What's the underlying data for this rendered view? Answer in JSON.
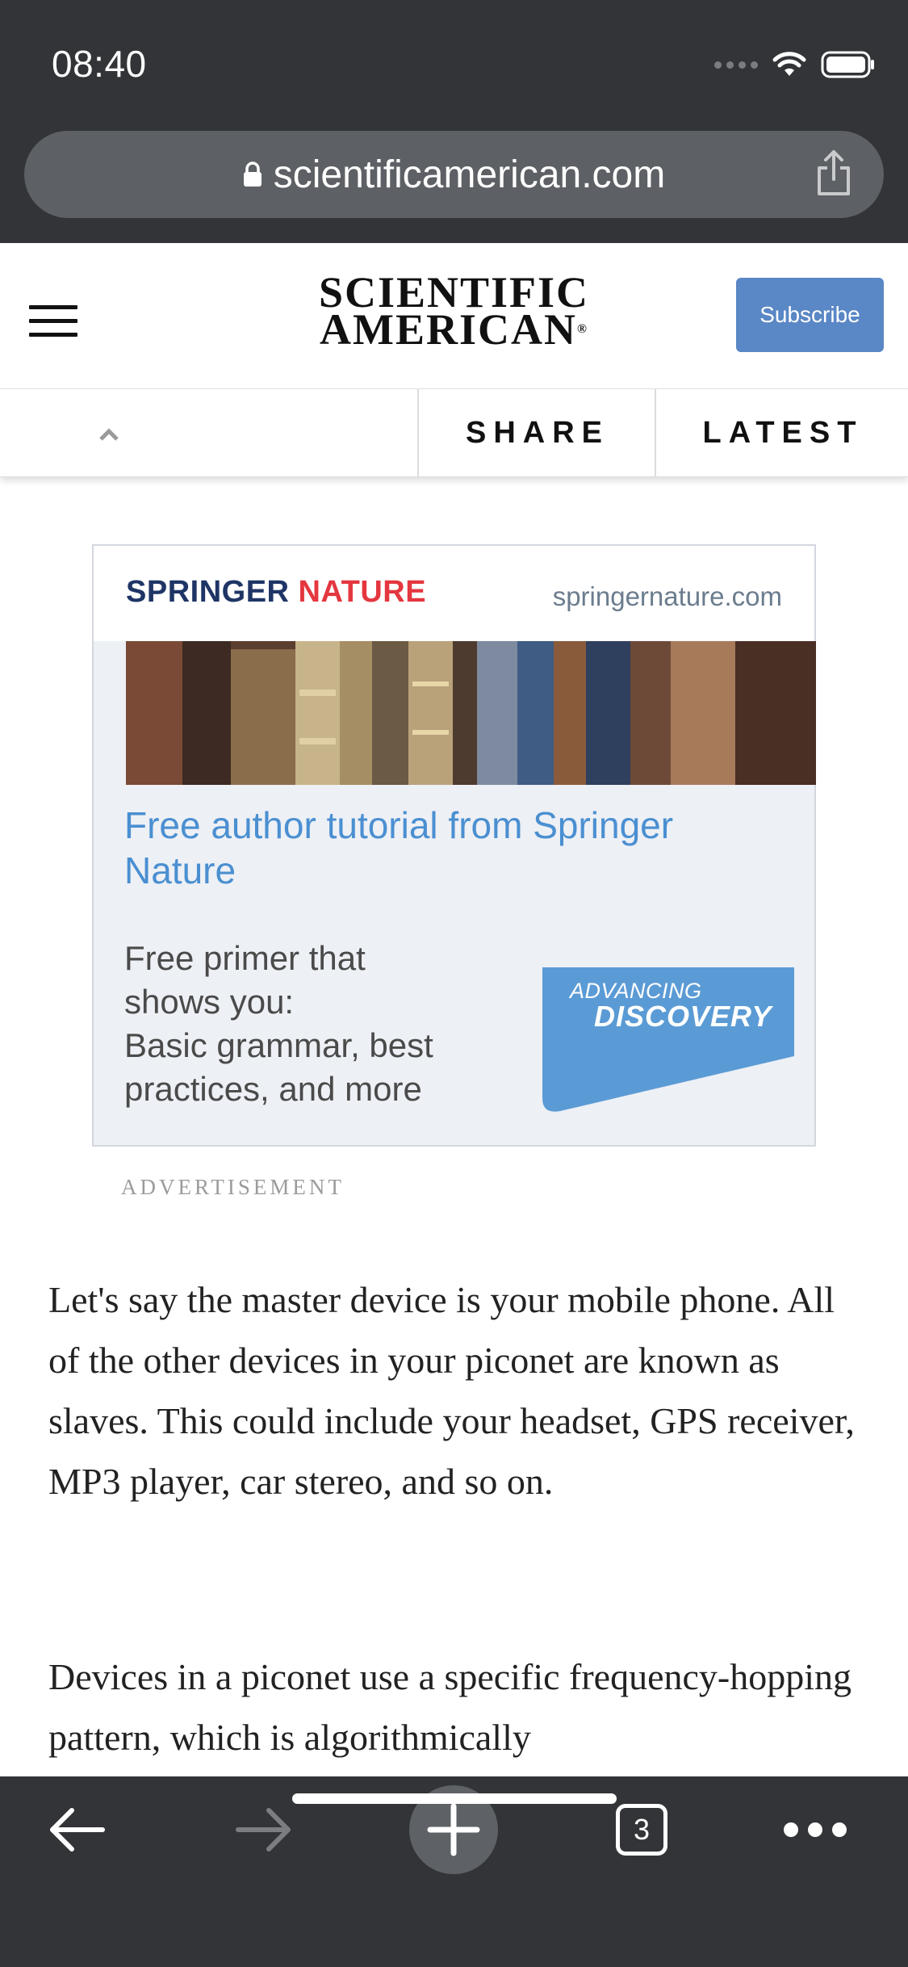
{
  "status_bar": {
    "time": "08:40"
  },
  "browser": {
    "url": "scientificamerican.com",
    "tab_count": "3"
  },
  "header": {
    "logo_line1": "SCIENTIFIC",
    "logo_line2": "AMERICAN",
    "logo_mark": "®",
    "subscribe_label": "Subscribe"
  },
  "toolbar": {
    "share_label": "SHARE",
    "latest_label": "LATEST"
  },
  "ad": {
    "brand_part1": "SPRINGER",
    "brand_part2": "NATURE",
    "domain": "springernature.com",
    "title": "Free author tutorial from Springer Nature",
    "body_line1": "Free primer that",
    "body_line2": "shows you:",
    "body_line3": "Basic grammar, best",
    "body_line4": "practices, and more",
    "badge_line1": "ADVANCING",
    "badge_line2": "DISCOVERY",
    "label": "ADVERTISEMENT",
    "brand_colors": {
      "navy": "#1f3566",
      "red": "#e4373f",
      "blue": "#4a8fd1"
    }
  },
  "article": {
    "paragraph1": "Let's say the master device is your mobile phone. All of the other devices in your piconet are known as slaves. This could include your headset, GPS receiver, MP3 player, car stereo, and so on.",
    "paragraph2": "Devices in a piconet use a specific frequency-hopping pattern, which is algorithmically"
  },
  "icons": {
    "status": [
      "signal-icon",
      "wifi-icon",
      "battery-icon"
    ],
    "url_bar": [
      "lock-icon",
      "share-icon"
    ],
    "bottom_bar": [
      "back-arrow-icon",
      "forward-arrow-icon",
      "plus-icon",
      "tabs-icon",
      "more-icon"
    ]
  }
}
